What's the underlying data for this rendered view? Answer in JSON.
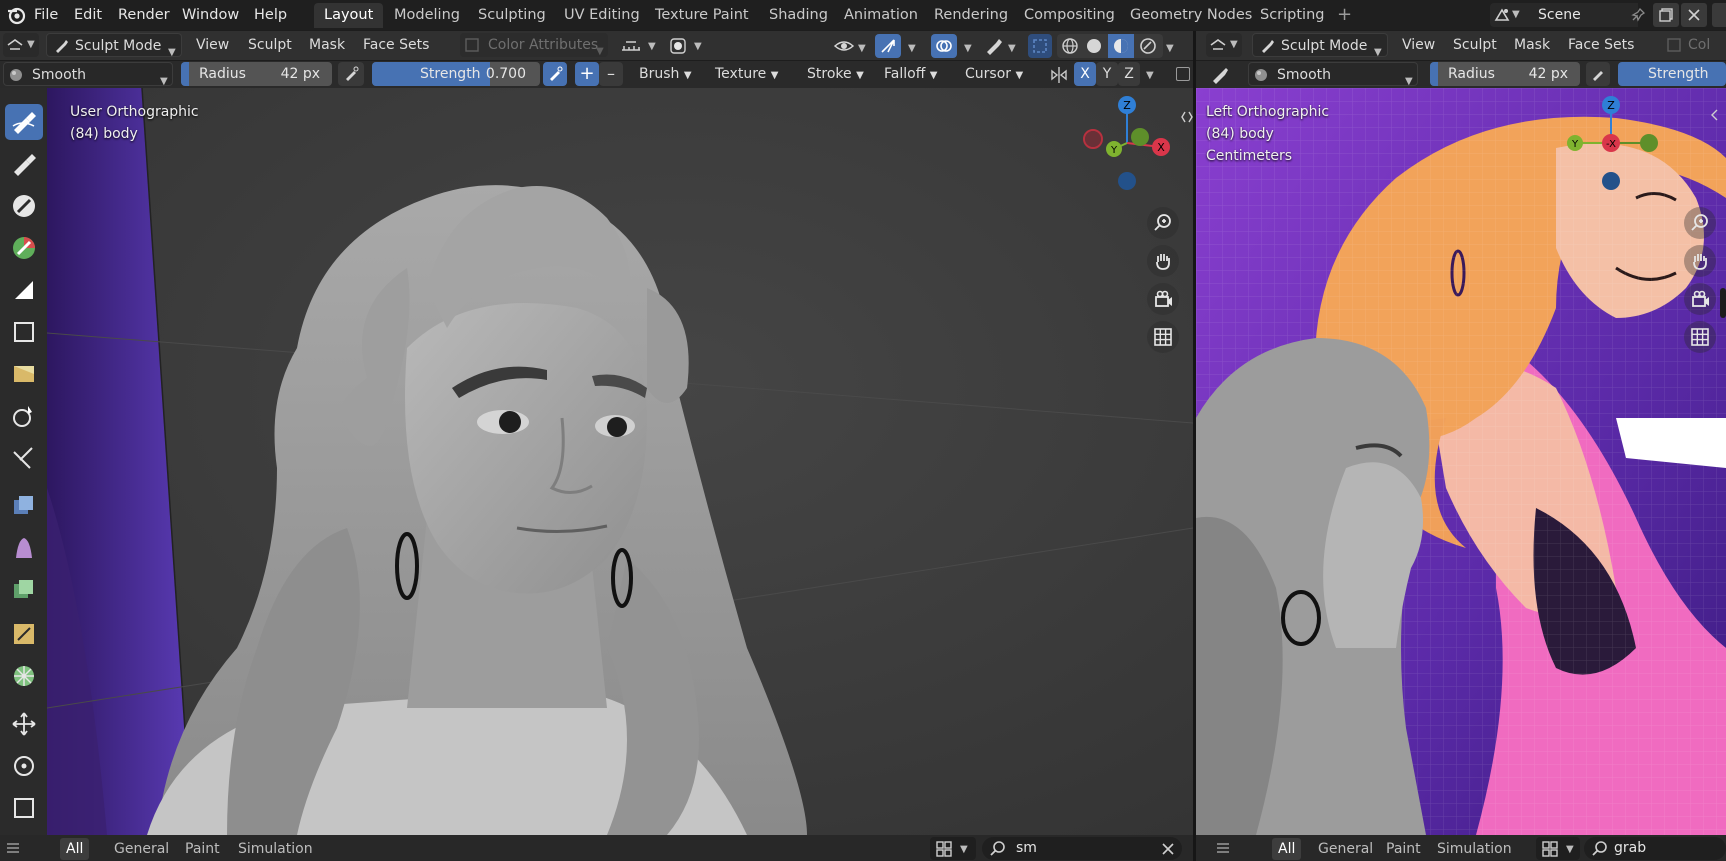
{
  "menubar": {
    "items": [
      "File",
      "Edit",
      "Render",
      "Window",
      "Help"
    ],
    "workspaces": [
      "Layout",
      "Modeling",
      "Sculpting",
      "UV Editing",
      "Texture Paint",
      "Shading",
      "Animation",
      "Rendering",
      "Compositing",
      "Geometry Nodes",
      "Scripting"
    ],
    "active_workspace": "Layout",
    "add_tab_label": "+",
    "scene_name": "Scene"
  },
  "main_header": {
    "mode": "Sculpt Mode",
    "menus": [
      "View",
      "Sculpt",
      "Mask",
      "Face Sets"
    ],
    "color_attributes": "Color Attributes"
  },
  "main_tool_settings": {
    "brush_name": "Smooth",
    "radius_label": "Radius",
    "radius_value": "42 px",
    "strength_label": "Strength",
    "strength_value": "0.700",
    "strength_fraction": 0.7,
    "plus_label": "+",
    "minus_label": "–",
    "panels": [
      "Brush",
      "Texture",
      "Stroke",
      "Falloff",
      "Cursor"
    ],
    "symmetry": [
      "X",
      "Y",
      "Z"
    ]
  },
  "main_viewport": {
    "view_name": "User Orthographic",
    "object_info": "(84) body"
  },
  "main_gizmo": {
    "x": "X",
    "y": "Y",
    "z": "Z"
  },
  "right_header": {
    "mode": "Sculpt Mode",
    "menus": [
      "View",
      "Sculpt",
      "Mask",
      "Face Sets"
    ],
    "overflow_label": "Col"
  },
  "right_tool_settings": {
    "brush_name": "Smooth",
    "radius_label": "Radius",
    "radius_value": "42 px",
    "strength_label": "Strength"
  },
  "right_viewport": {
    "view_name": "Left Orthographic",
    "object_info": "(84) body",
    "units": "Centimeters"
  },
  "right_gizmo": {
    "neg_x": "-X",
    "y": "Y",
    "z": "Z"
  },
  "bottom_main": {
    "tabs": [
      "All",
      "General",
      "Paint",
      "Simulation"
    ],
    "active_tab": "All",
    "search_value": "sm"
  },
  "bottom_right": {
    "tabs": [
      "All",
      "General",
      "Paint",
      "Simulation"
    ],
    "active_tab": "All",
    "search_value": "grab"
  },
  "colors": {
    "accent_blue": "#4772b3",
    "axis_x": "#d9364a",
    "axis_y": "#7fb32f",
    "axis_z": "#2f7fd6",
    "viewport_bg": "#3d3d3d"
  }
}
